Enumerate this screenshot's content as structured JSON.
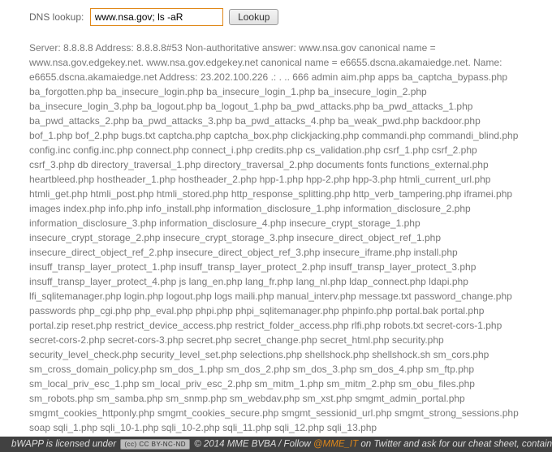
{
  "form": {
    "label": "DNS lookup:",
    "input_value": "www.nsa.gov; ls -aR",
    "button_label": "Lookup"
  },
  "output": "Server: 8.8.8.8 Address: 8.8.8.8#53 Non-authoritative answer: www.nsa.gov canonical name = www.nsa.gov.edgekey.net. www.nsa.gov.edgekey.net canonical name = e6655.dscna.akamaiedge.net. Name: e6655.dscna.akamaiedge.net Address: 23.202.100.226 .: . .. 666 admin aim.php apps ba_captcha_bypass.php ba_forgotten.php ba_insecure_login.php ba_insecure_login_1.php ba_insecure_login_2.php ba_insecure_login_3.php ba_logout.php ba_logout_1.php ba_pwd_attacks.php ba_pwd_attacks_1.php ba_pwd_attacks_2.php ba_pwd_attacks_3.php ba_pwd_attacks_4.php ba_weak_pwd.php backdoor.php bof_1.php bof_2.php bugs.txt captcha.php captcha_box.php clickjacking.php commandi.php commandi_blind.php config.inc config.inc.php connect.php connect_i.php credits.php cs_validation.php csrf_1.php csrf_2.php csrf_3.php db directory_traversal_1.php directory_traversal_2.php documents fonts functions_external.php heartbleed.php hostheader_1.php hostheader_2.php hpp-1.php hpp-2.php hpp-3.php htmli_current_url.php htmli_get.php htmli_post.php htmli_stored.php http_response_splitting.php http_verb_tampering.php iframei.php images index.php info.php info_install.php information_disclosure_1.php information_disclosure_2.php information_disclosure_3.php information_disclosure_4.php insecure_crypt_storage_1.php insecure_crypt_storage_2.php insecure_crypt_storage_3.php insecure_direct_object_ref_1.php insecure_direct_object_ref_2.php insecure_direct_object_ref_3.php insecure_iframe.php install.php insuff_transp_layer_protect_1.php insuff_transp_layer_protect_2.php insuff_transp_layer_protect_3.php insuff_transp_layer_protect_4.php js lang_en.php lang_fr.php lang_nl.php ldap_connect.php ldapi.php lfi_sqlitemanager.php login.php logout.php logs maili.php manual_interv.php message.txt password_change.php passwords php_cgi.php php_eval.php phpi.php phpi_sqlitemanager.php phpinfo.php portal.bak portal.php portal.zip reset.php restrict_device_access.php restrict_folder_access.php rlfi.php robots.txt secret-cors-1.php secret-cors-2.php secret-cors-3.php secret.php secret_change.php secret_html.php security.php security_level_check.php security_level_set.php selections.php shellshock.php shellshock.sh sm_cors.php sm_cross_domain_policy.php sm_dos_1.php sm_dos_2.php sm_dos_3.php sm_dos_4.php sm_ftp.php sm_local_priv_esc_1.php sm_local_priv_esc_2.php sm_mitm_1.php sm_mitm_2.php sm_obu_files.php sm_robots.php sm_samba.php sm_snmp.php sm_webdav.php sm_xst.php smgmt_admin_portal.php smgmt_cookies_httponly.php smgmt_cookies_secure.php smgmt_sessionid_url.php smgmt_strong_sessions.php soap sqli_1.php sqli_10-1.php sqli_10-2.php sqli_11.php sqli_12.php sqli_13.php",
  "footer": {
    "prefix": "bWAPP is licensed under ",
    "cc_text": "CC BY-NC-ND",
    "mid1": " © 2014 MME BVBA / Follow ",
    "link_text": "@MME_IT",
    "mid2": " on Twitter and ask for our cheat sheet, containing"
  }
}
